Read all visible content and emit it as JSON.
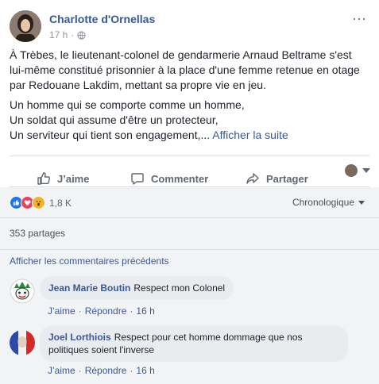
{
  "post": {
    "author": "Charlotte d'Ornellas",
    "time": "17 h",
    "dot": "·",
    "more": "···",
    "paragraph1": "À Trèbes, le lieutenant-colonel de gendarmerie Arnaud Beltrame s'est lui-même constitué prisonnier à la place d'une femme retenue en otage par Redouane Lakdim, mettant sa propre vie en jeu.",
    "line1": "Un homme qui se comporte comme un homme,",
    "line2": "Un soldat qui assume d'être un protecteur,",
    "line3": "Un serviteur qui tient son engagement,...",
    "see_more": "Afficher la suite"
  },
  "actions": {
    "like": "J’aime",
    "comment": "Commenter",
    "share": "Partager"
  },
  "reactions": {
    "count": "1,8 K",
    "types": [
      "like",
      "love",
      "wow"
    ],
    "sort": "Chronologique"
  },
  "shares": "353 partages",
  "comments": {
    "previous": "Afficher les commentaires précédents",
    "items": [
      {
        "name": "Jean Marie Boutin",
        "text": "Respect mon Colonel",
        "like": "J’aime",
        "sep": "·",
        "reply": "Répondre",
        "time": "16 h"
      },
      {
        "name": "Joel Lorthiois",
        "text": "Respect pour cet homme dommage que nos politiques soient l'inverse",
        "like": "J’aime",
        "sep": "·",
        "reply": "Répondre",
        "time": "16 h"
      }
    ]
  },
  "colors": {
    "link": "#365899",
    "like_blue": "#1877f2",
    "love_red": "#f33e58",
    "wow_yellow": "#f7b125",
    "background_gray": "#f2f3f5"
  }
}
